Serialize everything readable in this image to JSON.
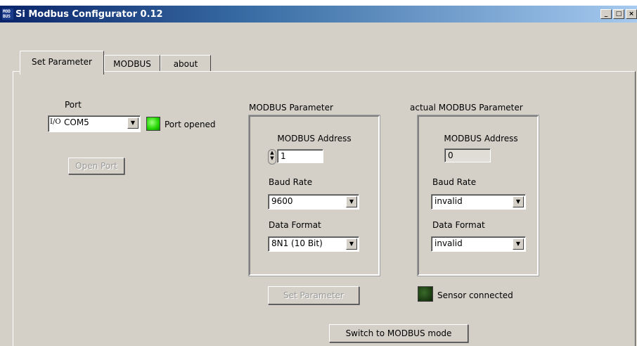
{
  "window": {
    "title": "Si Modbus Configurator 0.12",
    "icon_text_top": "MOD",
    "icon_text_bottom": "BUS",
    "controls": {
      "minimize": "_",
      "maximize": "□",
      "close": "×"
    }
  },
  "tabs": [
    {
      "label": "Set Parameter",
      "selected": true
    },
    {
      "label": "MODBUS",
      "selected": false
    },
    {
      "label": "about",
      "selected": false
    }
  ],
  "port": {
    "label": "Port",
    "io_icon": "I/O",
    "value": "COM5",
    "status_text": "Port opened",
    "open_button": "Open Port"
  },
  "modbus_parameter": {
    "title": "MODBUS Parameter",
    "address_label": "MODBUS Address",
    "address_value": "1",
    "baud_label": "Baud Rate",
    "baud_value": "9600",
    "format_label": "Data Format",
    "format_value": "8N1 (10 Bit)",
    "set_button": "Set Parameter"
  },
  "actual_parameter": {
    "title": "actual MODBUS Parameter",
    "address_label": "MODBUS Address",
    "address_value": "0",
    "baud_label": "Baud Rate",
    "baud_value": "invalid",
    "format_label": "Data Format",
    "format_value": "invalid",
    "sensor_status": "Sensor connected"
  },
  "switch_button": "Switch to MODBUS mode",
  "colors": {
    "led_on": "#22d600",
    "led_off": "#1b3a12",
    "titlebar_start": "#0a246a",
    "titlebar_end": "#a6caf0"
  }
}
